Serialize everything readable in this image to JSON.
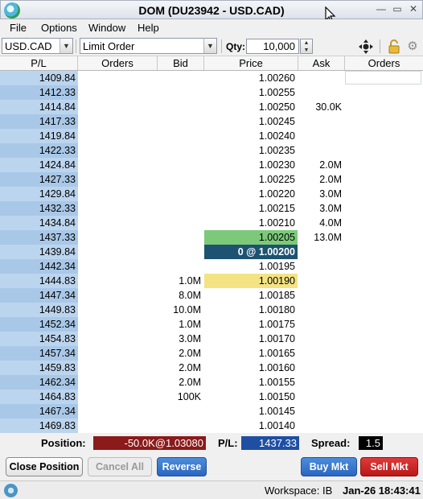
{
  "window": {
    "title": "DOM (DU23942 - USD.CAD)",
    "minimize_glyph": "—",
    "restore_glyph": "▭",
    "close_glyph": "✕"
  },
  "menu": [
    "File",
    "Options",
    "Window",
    "Help"
  ],
  "toolbar": {
    "symbol": "USD.CAD",
    "order_type": "Limit Order",
    "qty_label": "Qty:",
    "qty_value": "10,000",
    "icons": [
      "crosshair-icon",
      "lock-icon",
      "gear-icon"
    ]
  },
  "columns": [
    "P/L",
    "Orders",
    "Bid",
    "Price",
    "Ask",
    "Orders"
  ],
  "rows": [
    {
      "pl": "1409.84",
      "bid": "",
      "price": "1.00260",
      "ask": ""
    },
    {
      "pl": "1412.33",
      "bid": "",
      "price": "1.00255",
      "ask": ""
    },
    {
      "pl": "1414.84",
      "bid": "",
      "price": "1.00250",
      "ask": "30.0K"
    },
    {
      "pl": "1417.33",
      "bid": "",
      "price": "1.00245",
      "ask": ""
    },
    {
      "pl": "1419.84",
      "bid": "",
      "price": "1.00240",
      "ask": ""
    },
    {
      "pl": "1422.33",
      "bid": "",
      "price": "1.00235",
      "ask": ""
    },
    {
      "pl": "1424.84",
      "bid": "",
      "price": "1.00230",
      "ask": "2.0M"
    },
    {
      "pl": "1427.33",
      "bid": "",
      "price": "1.00225",
      "ask": "2.0M"
    },
    {
      "pl": "1429.84",
      "bid": "",
      "price": "1.00220",
      "ask": "3.0M"
    },
    {
      "pl": "1432.33",
      "bid": "",
      "price": "1.00215",
      "ask": "3.0M"
    },
    {
      "pl": "1434.84",
      "bid": "",
      "price": "1.00210",
      "ask": "4.0M"
    },
    {
      "pl": "1437.33",
      "bid": "",
      "price": "1.00205",
      "ask": "13.0M",
      "state": "ask-best"
    },
    {
      "pl": "1439.84",
      "bid": "",
      "price": "0 @ 1.00200",
      "ask": "",
      "state": "last"
    },
    {
      "pl": "1442.34",
      "bid": "",
      "price": "1.00195",
      "ask": ""
    },
    {
      "pl": "1444.83",
      "bid": "1.0M",
      "price": "1.00190",
      "ask": "",
      "state": "bid-best"
    },
    {
      "pl": "1447.34",
      "bid": "8.0M",
      "price": "1.00185",
      "ask": ""
    },
    {
      "pl": "1449.83",
      "bid": "10.0M",
      "price": "1.00180",
      "ask": ""
    },
    {
      "pl": "1452.34",
      "bid": "1.0M",
      "price": "1.00175",
      "ask": ""
    },
    {
      "pl": "1454.83",
      "bid": "3.0M",
      "price": "1.00170",
      "ask": ""
    },
    {
      "pl": "1457.34",
      "bid": "2.0M",
      "price": "1.00165",
      "ask": ""
    },
    {
      "pl": "1459.83",
      "bid": "2.0M",
      "price": "1.00160",
      "ask": ""
    },
    {
      "pl": "1462.34",
      "bid": "2.0M",
      "price": "1.00155",
      "ask": ""
    },
    {
      "pl": "1464.83",
      "bid": "100K",
      "price": "1.00150",
      "ask": ""
    },
    {
      "pl": "1467.34",
      "bid": "",
      "price": "1.00145",
      "ask": ""
    },
    {
      "pl": "1469.83",
      "bid": "",
      "price": "1.00140",
      "ask": ""
    }
  ],
  "position": {
    "position_label": "Position:",
    "position_value": "-50.0K@1.03080",
    "pl_label": "P/L:",
    "pl_value": "1437.33",
    "spread_label": "Spread:",
    "spread_value": "1.5"
  },
  "buttons": {
    "close_position": "Close Position",
    "cancel_all": "Cancel All",
    "reverse": "Reverse",
    "buy_mkt": "Buy Mkt",
    "sell_mkt": "Sell Mkt"
  },
  "status": {
    "workspace": "Workspace: IB",
    "datetime": "Jan-26 18:43:41"
  },
  "colors": {
    "ask_best": "#7cc97a",
    "bid_best": "#f3e383",
    "last_price": "#1d5270",
    "position_value_bg": "#8b1a1a",
    "pl_value_bg": "#1f4fa3",
    "pl_column": "#bcd5ee"
  }
}
